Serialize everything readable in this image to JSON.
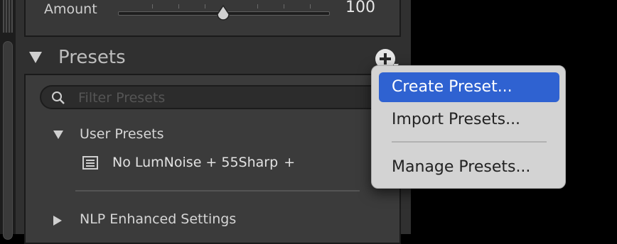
{
  "develop": {
    "amount": {
      "label": "Amount",
      "value": "100",
      "level": 0.5
    }
  },
  "presets": {
    "title": "Presets",
    "add_icon": "plus-with-dropdown-arrow",
    "filter_placeholder": "Filter Presets",
    "groups": [
      {
        "label": "User Presets",
        "expanded": true,
        "items": [
          {
            "name": "No LumNoise + 55Sharp",
            "suffix": "+",
            "icon": "preset-list-icon"
          }
        ]
      },
      {
        "label": "NLP Enhanced Settings",
        "expanded": false
      }
    ]
  },
  "context_menu": {
    "items": [
      {
        "label": "Create Preset...",
        "highlighted": true
      },
      {
        "label": "Import Presets..."
      },
      {
        "label": "Manage Presets..."
      }
    ],
    "highlight_color": "#2f62d1"
  }
}
